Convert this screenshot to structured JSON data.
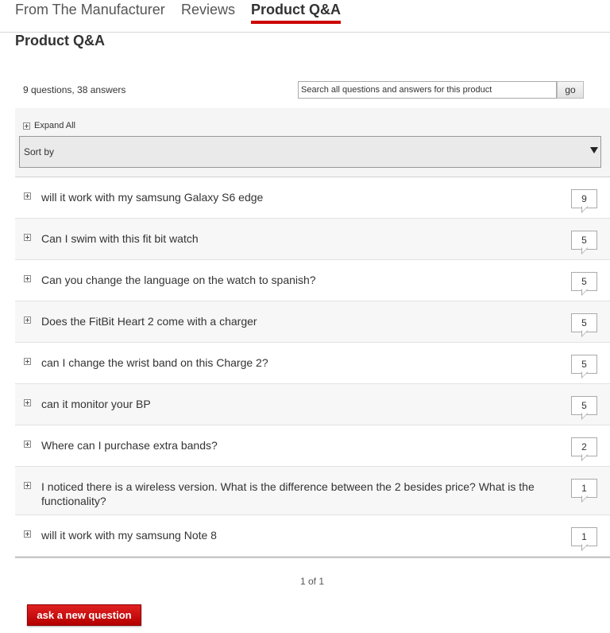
{
  "tabs": [
    {
      "label": "From The Manufacturer"
    },
    {
      "label": "Reviews"
    },
    {
      "label": "Product Q&A"
    }
  ],
  "accent_color": "#cc0000",
  "section_title": "Product Q&A",
  "summary": {
    "text": "9 questions, 38 answers",
    "search_placeholder": "Search all questions and answers for this product",
    "go_label": "go"
  },
  "controls": {
    "expand_all": "Expand All",
    "sort_label": "Sort by"
  },
  "questions": [
    {
      "text": "will it work with my samsung Galaxy S6 edge",
      "answers": "9"
    },
    {
      "text": "Can I swim with this fit bit watch",
      "answers": "5"
    },
    {
      "text": "Can you change the language on the watch to spanish?",
      "answers": "5"
    },
    {
      "text": "Does the FitBit Heart 2 come with a charger",
      "answers": "5"
    },
    {
      "text": "can I change the wrist band on this Charge 2?",
      "answers": "5"
    },
    {
      "text": "can it monitor your BP",
      "answers": "5"
    },
    {
      "text": "Where can I purchase extra bands?",
      "answers": "2"
    },
    {
      "text": "I noticed there is a wireless version. What is the difference between the 2 besides price? What is the functionality?",
      "answers": "1"
    },
    {
      "text": "will it work with my samsung Note 8",
      "answers": "1"
    }
  ],
  "pagination": "1 of 1",
  "ask_button": "ask a new question"
}
